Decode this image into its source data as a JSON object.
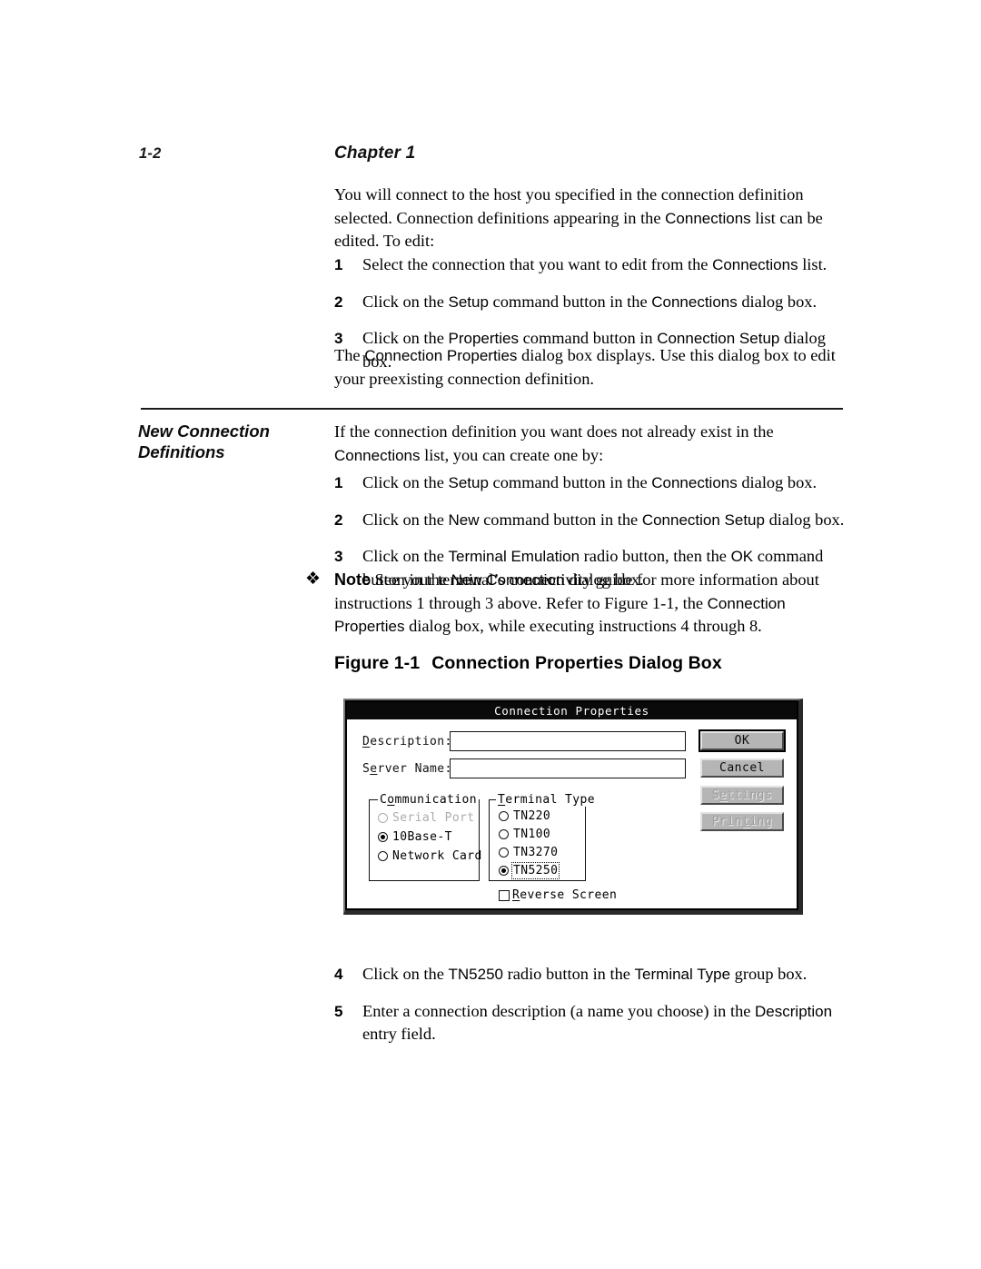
{
  "page": {
    "folio": "1-2",
    "chapter": "Chapter 1"
  },
  "intro": {
    "paragraph_pre": "You will connect to the host you specified in the connection definition selected. Connection definitions appearing in the ",
    "paragraph_ui": "Connections",
    "paragraph_post": " list can be edited. To edit:"
  },
  "edit_steps": [
    {
      "num": "1",
      "pre": "Select the connection that you want to edit from the ",
      "ui": "Connections",
      "post": " list."
    },
    {
      "num": "2",
      "pre": "Click on the ",
      "ui": "Setup",
      "mid": " command button in the ",
      "ui2": "Connections",
      "post": " dialog box."
    },
    {
      "num": "3",
      "pre": "Click on the ",
      "ui": "Properties",
      "mid": " command button in ",
      "ui2": "Connection Setup",
      "post": " dialog box."
    }
  ],
  "after_edit": {
    "pre": "The ",
    "ui": "Connection Properties",
    "post": " dialog box displays. Use this dialog box to edit your preexisting connection definition."
  },
  "sidehead": {
    "line1": "New Connection",
    "line2": "Definitions"
  },
  "new_conn": {
    "intro_pre": "If the connection definition you want does not already exist in the ",
    "intro_ui": "Connections",
    "intro_post": " list, you can create one by:",
    "steps": [
      {
        "num": "1",
        "pre": "Click on the ",
        "ui": "Setup",
        "mid": " command button in the ",
        "ui2": "Connections",
        "post": " dialog box."
      },
      {
        "num": "2",
        "pre": "Click on the ",
        "ui": "New",
        "mid": " command button in the ",
        "ui2": "Connection Setup",
        "post": " dialog box."
      },
      {
        "num": "3",
        "pre": "Click on the ",
        "ui": "Terminal Emulation",
        "mid": " radio button, then the ",
        "ui2": "OK",
        "post": " command button in the ",
        "ui3": "New Connection",
        "post2": " dialog box."
      }
    ]
  },
  "note": {
    "bullet": "❖",
    "label": "Note",
    "pre": "  See your terminal’s connectivity guide for more information about instructions 1 through 3 above. Refer to Figure 1-1, the ",
    "ui": "Connection Properties",
    "post": " dialog box, while executing instructions 4 through 8."
  },
  "figure": {
    "label": "Figure 1-1",
    "title": "Connection Properties Dialog Box"
  },
  "dialog": {
    "title": "Connection Properties",
    "fields": [
      {
        "label_acc": "D",
        "label_rest": "escription:",
        "value": "",
        "placeholder": ""
      },
      {
        "label_acc_pre": "S",
        "label_acc": "e",
        "label_rest": "rver Name:",
        "value": "",
        "placeholder": ""
      }
    ],
    "buttons": [
      {
        "label": "OK",
        "state": "default"
      },
      {
        "label": "Cancel",
        "state": "enabled"
      },
      {
        "label_pre": "S",
        "label_acc": "e",
        "label_rest": "ttings",
        "label": "Settings",
        "state": "disabled"
      },
      {
        "label_pre": "Prin",
        "label_acc": "t",
        "label_rest": "ing",
        "label": "Printing",
        "state": "disabled"
      }
    ],
    "communication": {
      "title_pre": "C",
      "title_acc": "o",
      "title_rest": "mmunication",
      "title": "Communication",
      "options": [
        {
          "label": "Serial Port",
          "selected": false,
          "disabled": true
        },
        {
          "label": "10Base-T",
          "selected": true,
          "disabled": false
        },
        {
          "label": "Network Card",
          "selected": false,
          "disabled": false
        }
      ]
    },
    "terminal_type": {
      "title_acc": "T",
      "title_rest": "erminal Type",
      "title": "Terminal Type",
      "options": [
        {
          "label": "TN220",
          "selected": false,
          "focused": false
        },
        {
          "label": "TN100",
          "selected": false,
          "focused": false
        },
        {
          "label": "TN3270",
          "selected": false,
          "focused": false
        },
        {
          "label": "TN5250",
          "selected": true,
          "focused": true
        }
      ]
    },
    "reverse_screen": {
      "acc": "R",
      "rest": "everse Screen",
      "label": "Reverse Screen",
      "checked": false
    }
  },
  "tail_steps": [
    {
      "num": "4",
      "pre": "Click on the ",
      "ui": "TN5250",
      "mid": " radio button in the ",
      "ui2": "Terminal Type",
      "post": " group box."
    },
    {
      "num": "5",
      "pre": "Enter a connection description (a name you choose) in the ",
      "ui": "Description",
      "post": " entry field."
    }
  ],
  "colors": {
    "page_bg": "#ffffff",
    "ink": "#000000",
    "titlebar_bg": "#0a0a0a",
    "button_face": "#b5b5b5",
    "disabled_text": "#9d9d9d"
  }
}
